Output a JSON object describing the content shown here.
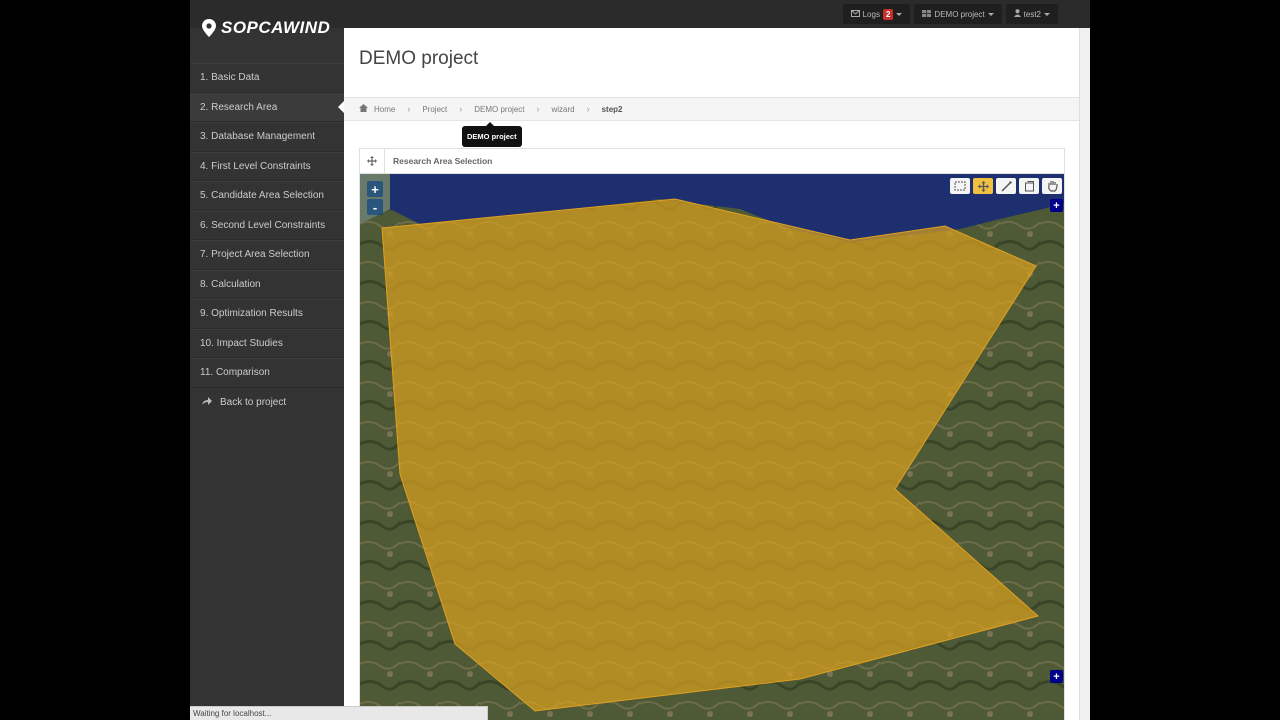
{
  "brand": {
    "name": "SOPCAWIND"
  },
  "navbar": {
    "logs_label": "Logs",
    "logs_count": "2",
    "project_label": "DEMO project",
    "user_label": "test2"
  },
  "sidebar": {
    "items": [
      {
        "label": "1. Basic Data"
      },
      {
        "label": "2. Research Area"
      },
      {
        "label": "3. Database Management"
      },
      {
        "label": "4. First Level Constraints"
      },
      {
        "label": "5. Candidate Area Selection"
      },
      {
        "label": "6. Second Level Constraints"
      },
      {
        "label": "7. Project Area Selection"
      },
      {
        "label": "8. Calculation"
      },
      {
        "label": "9. Optimization Results"
      },
      {
        "label": "10. Impact Studies"
      },
      {
        "label": "11. Comparison"
      }
    ],
    "back_label": "Back to project"
  },
  "page": {
    "title": "DEMO project"
  },
  "breadcrumb": {
    "items": [
      "Home",
      "Project",
      "DEMO project",
      "wizard",
      "step2"
    ]
  },
  "tooltip": {
    "text": "DEMO project"
  },
  "panel": {
    "title": "Research Area Selection"
  },
  "map": {
    "zoom_in": "+",
    "zoom_out": "-",
    "polygon_fill": "#d8a020",
    "tools": [
      "select-area-icon",
      "move-icon",
      "draw-icon",
      "modify-icon",
      "pan-hand-icon"
    ],
    "active_tool": "move-icon"
  },
  "status": {
    "text": "Waiting for localhost..."
  },
  "colors": {
    "sidebar_bg": "#333333",
    "navbar_bg": "#2b2b2b",
    "badge": "#c9302c"
  }
}
